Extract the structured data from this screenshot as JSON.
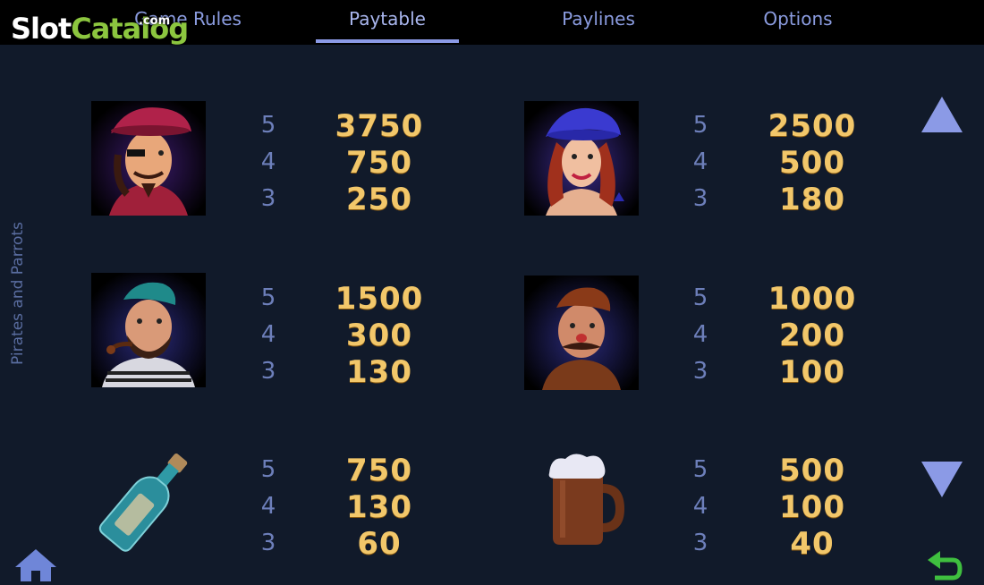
{
  "tabs": [
    {
      "label": "Game Rules",
      "active": false
    },
    {
      "label": "Paytable",
      "active": true
    },
    {
      "label": "Paylines",
      "active": false
    },
    {
      "label": "Options",
      "active": false
    }
  ],
  "watermark": {
    "slot": "Slot",
    "catalog": "Catalog",
    "com": ".com"
  },
  "side_title": "Pirates and Parrots",
  "paytable": [
    {
      "symbol": "pirate-captain-icon",
      "counts": [
        "5",
        "4",
        "3"
      ],
      "payouts": [
        "3750",
        "750",
        "250"
      ]
    },
    {
      "symbol": "pirate-lady-icon",
      "counts": [
        "5",
        "4",
        "3"
      ],
      "payouts": [
        "2500",
        "500",
        "180"
      ]
    },
    {
      "symbol": "bearded-pirate-icon",
      "counts": [
        "5",
        "4",
        "3"
      ],
      "payouts": [
        "1500",
        "300",
        "130"
      ]
    },
    {
      "symbol": "mustached-pirate-icon",
      "counts": [
        "5",
        "4",
        "3"
      ],
      "payouts": [
        "1000",
        "200",
        "100"
      ]
    },
    {
      "symbol": "message-bottle-icon",
      "counts": [
        "5",
        "4",
        "3"
      ],
      "payouts": [
        "750",
        "130",
        "60"
      ]
    },
    {
      "symbol": "beer-mug-icon",
      "counts": [
        "5",
        "4",
        "3"
      ],
      "payouts": [
        "500",
        "100",
        "40"
      ]
    }
  ],
  "colors": {
    "background": "#111a2a",
    "tab_text": "#8b9ce0",
    "payout": "#f2c76a",
    "count": "#6d7fba",
    "arrow": "#8b9ae6",
    "back_arrow": "#3fbf3f"
  },
  "controls": {
    "scroll_up": "triangle-up-icon",
    "scroll_down": "triangle-down-icon",
    "home": "home-icon",
    "back": "back-arrow-icon"
  }
}
